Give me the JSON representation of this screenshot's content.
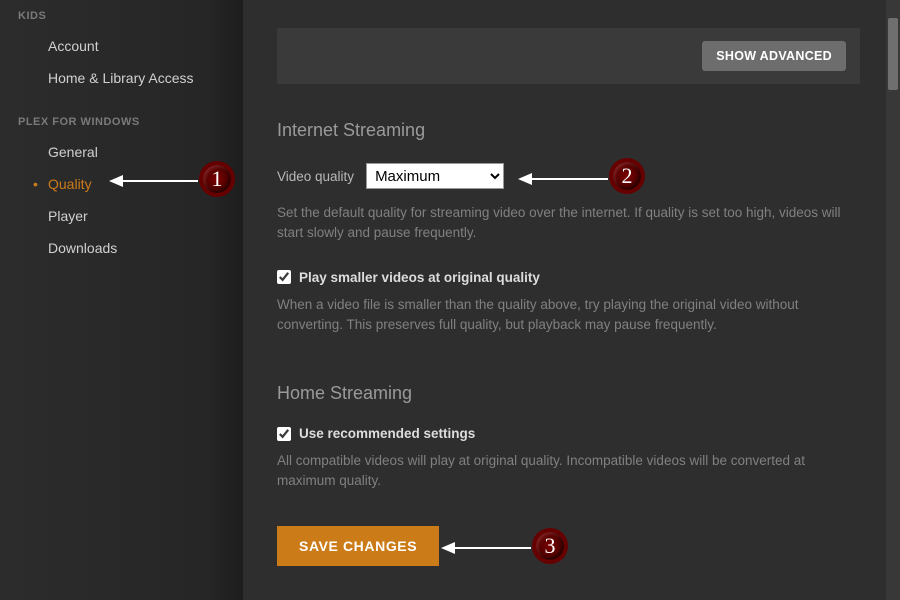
{
  "sidebar": {
    "section1_header": "KIDS",
    "section1_items": [
      "Account",
      "Home & Library Access"
    ],
    "section2_header": "PLEX FOR WINDOWS",
    "section2_items": [
      "General",
      "Quality",
      "Player",
      "Downloads"
    ],
    "active_index": 1
  },
  "advanced_button": "SHOW ADVANCED",
  "internet": {
    "title": "Internet Streaming",
    "video_quality_label": "Video quality",
    "video_quality_value": "Maximum",
    "video_quality_help": "Set the default quality for streaming video over the internet. If quality is set too high, videos will start slowly and pause frequently.",
    "smaller_checked": true,
    "smaller_label": "Play smaller videos at original quality",
    "smaller_help": "When a video file is smaller than the quality above, try playing the original video without converting. This preserves full quality, but playback may pause frequently."
  },
  "home": {
    "title": "Home Streaming",
    "recommended_checked": true,
    "recommended_label": "Use recommended settings",
    "recommended_help": "All compatible videos will play at original quality. Incompatible videos will be converted at maximum quality."
  },
  "save_label": "SAVE CHANGES",
  "annotations": {
    "a1": "1",
    "a2": "2",
    "a3": "3"
  }
}
